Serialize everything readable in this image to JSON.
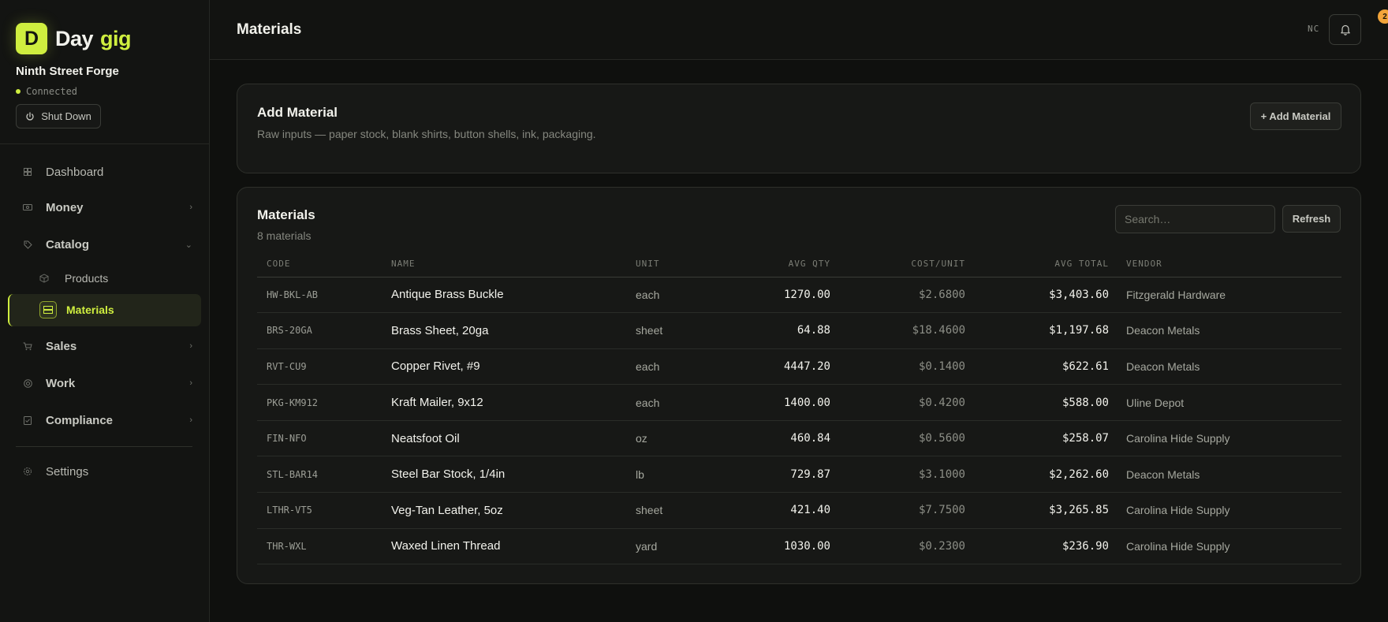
{
  "app": {
    "logo_letter": "D",
    "name_part1": "Day",
    "name_part2": "gig",
    "org_name": "Ninth Street Forge",
    "status": "Connected",
    "shutdown_label": "Shut Down",
    "accent_color": "#cfee3f"
  },
  "sidebar": {
    "dashboard": "Dashboard",
    "money": "Money",
    "catalog": "Catalog",
    "products": "Products",
    "materials": "Materials",
    "sales": "Sales",
    "work": "Work",
    "compliance": "Compliance",
    "settings": "Settings"
  },
  "header": {
    "title": "Materials",
    "user_initials": "NC",
    "notification_count": "2"
  },
  "add_card": {
    "title": "Add Material",
    "description": "Raw inputs — paper stock, blank shirts, button shells, ink, packaging.",
    "button": "+ Add Material"
  },
  "table_card": {
    "title": "Materials",
    "count": "8 materials",
    "search_placeholder": "Search…",
    "refresh": "Refresh",
    "columns": [
      "CODE",
      "NAME",
      "UNIT",
      "AVG QTY",
      "COST/UNIT",
      "AVG TOTAL",
      "VENDOR"
    ],
    "rows": [
      {
        "code": "HW-BKL-AB",
        "name": "Antique Brass Buckle",
        "unit": "each",
        "qty": "1270.00",
        "cost": "$2.6800",
        "total": "$3,403.60",
        "vendor": "Fitzgerald Hardware"
      },
      {
        "code": "BRS-20GA",
        "name": "Brass Sheet, 20ga",
        "unit": "sheet",
        "qty": "64.88",
        "cost": "$18.4600",
        "total": "$1,197.68",
        "vendor": "Deacon Metals"
      },
      {
        "code": "RVT-CU9",
        "name": "Copper Rivet, #9",
        "unit": "each",
        "qty": "4447.20",
        "cost": "$0.1400",
        "total": "$622.61",
        "vendor": "Deacon Metals"
      },
      {
        "code": "PKG-KM912",
        "name": "Kraft Mailer, 9x12",
        "unit": "each",
        "qty": "1400.00",
        "cost": "$0.4200",
        "total": "$588.00",
        "vendor": "Uline Depot"
      },
      {
        "code": "FIN-NFO",
        "name": "Neatsfoot Oil",
        "unit": "oz",
        "qty": "460.84",
        "cost": "$0.5600",
        "total": "$258.07",
        "vendor": "Carolina Hide Supply"
      },
      {
        "code": "STL-BAR14",
        "name": "Steel Bar Stock, 1/4in",
        "unit": "lb",
        "qty": "729.87",
        "cost": "$3.1000",
        "total": "$2,262.60",
        "vendor": "Deacon Metals"
      },
      {
        "code": "LTHR-VT5",
        "name": "Veg-Tan Leather, 5oz",
        "unit": "sheet",
        "qty": "421.40",
        "cost": "$7.7500",
        "total": "$3,265.85",
        "vendor": "Carolina Hide Supply"
      },
      {
        "code": "THR-WXL",
        "name": "Waxed Linen Thread",
        "unit": "yard",
        "qty": "1030.00",
        "cost": "$0.2300",
        "total": "$236.90",
        "vendor": "Carolina Hide Supply"
      }
    ]
  }
}
